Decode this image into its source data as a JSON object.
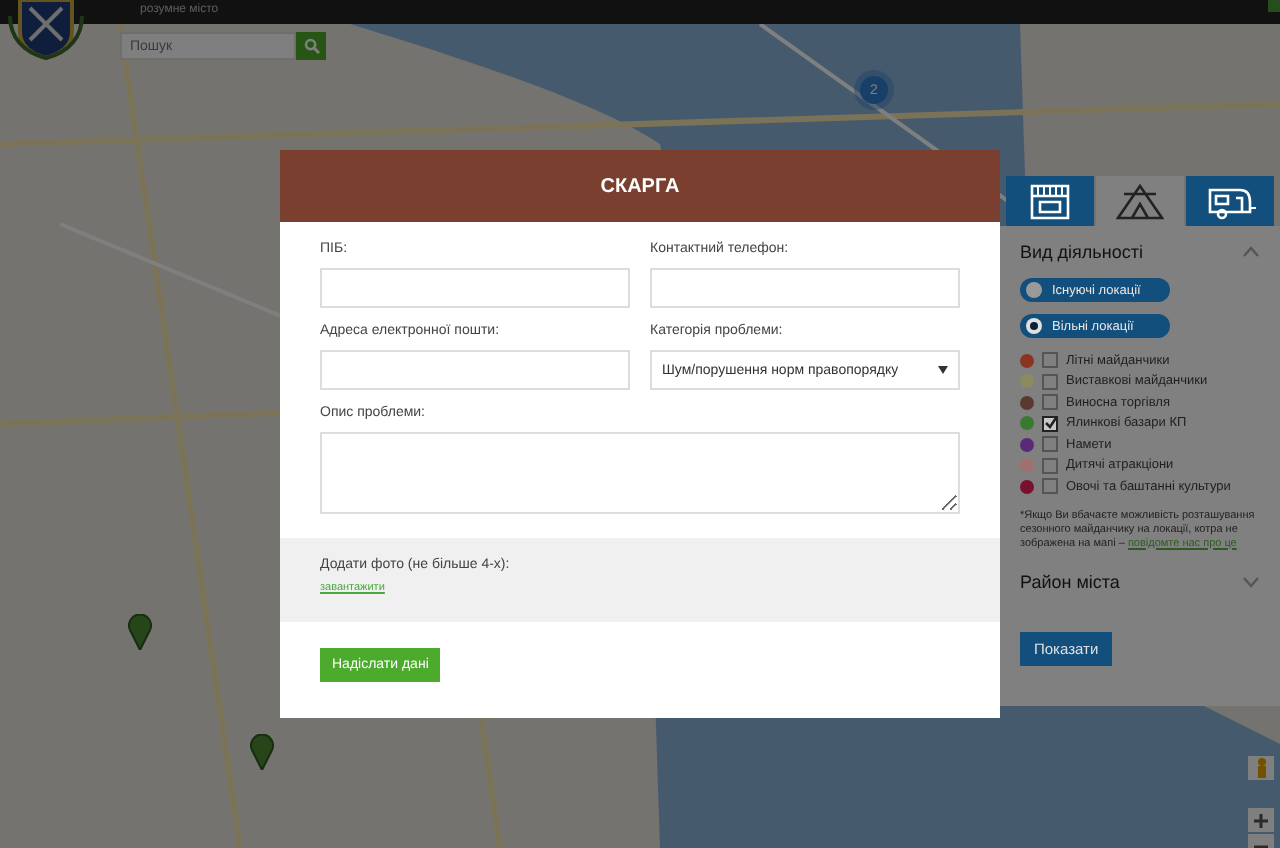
{
  "header": {
    "subtitle": "розумне місто"
  },
  "search": {
    "placeholder": "Пошук"
  },
  "map": {
    "cluster_count": "2"
  },
  "sidebar": {
    "tabs": [
      {
        "kind": "shop",
        "selected": false
      },
      {
        "kind": "tent",
        "selected": true
      },
      {
        "kind": "caravan",
        "selected": false
      }
    ],
    "activity": {
      "title": "Вид діяльності",
      "expanded": true,
      "locations": [
        {
          "label": "Існуючі локації",
          "selected": false
        },
        {
          "label": "Вільні локації",
          "selected": true
        }
      ],
      "categories": [
        {
          "label": "Літні майданчики",
          "color": "#8a3424",
          "checked": false
        },
        {
          "label": "Виставкові майданчики",
          "color": "#8c8a60",
          "checked": false
        },
        {
          "label": "Виносна торгівля",
          "color": "#5a3a30",
          "checked": false
        },
        {
          "label": "Ялинкові базари КП",
          "color": "#3a7a30",
          "checked": true
        },
        {
          "label": "Намети",
          "color": "#5a2a78",
          "checked": false
        },
        {
          "label": "Дитячі атракціони",
          "color": "#a07070",
          "checked": false
        },
        {
          "label": "Овочі та баштанні культури",
          "color": "#7a1030",
          "checked": false
        }
      ],
      "note": {
        "text": "*Якщо Ви вбачаєте можливість розташування сезонного майданчику на локації, котра не зображена на мапі –",
        "link": "повідомте нас про це"
      }
    },
    "district": {
      "title": "Район міста",
      "expanded": false
    },
    "show_button": "Показати"
  },
  "modal": {
    "title": "СКАРГА",
    "fields": [
      {
        "label": "ПІБ:",
        "kind": "text"
      },
      {
        "label": "Контактний телефон:",
        "kind": "text"
      },
      {
        "label": "Адреса електронної пошти:",
        "kind": "text"
      },
      {
        "label": "Категорія проблеми:",
        "kind": "select",
        "value": "Шум/порушення норм правопорядку"
      },
      {
        "label": "Опис проблеми:",
        "kind": "textarea"
      }
    ],
    "photo": {
      "label": "Додати фото (не більше 4-х):",
      "link": "завантажити"
    },
    "submit": "Надіслати дані"
  }
}
